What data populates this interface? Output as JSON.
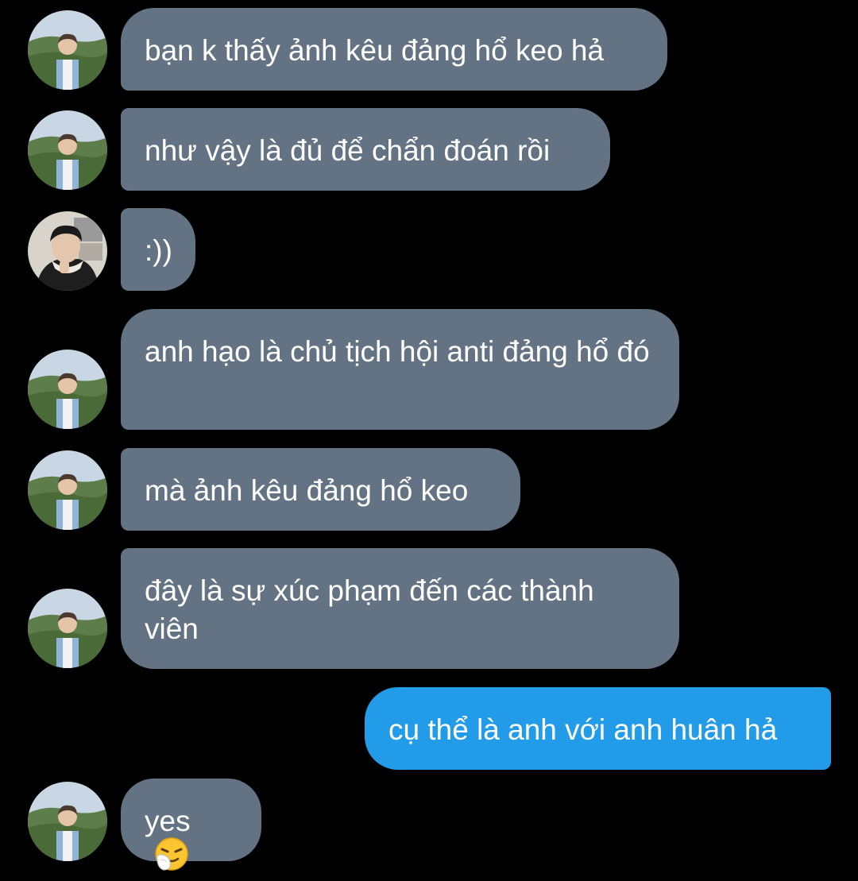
{
  "conversation": {
    "messages": [
      {
        "sender": "contact",
        "text": "bạn k thấy ảnh kêu đảng hổ keo hả",
        "avatar": "landscape-portrait-avatar"
      },
      {
        "sender": "contact",
        "text": "như vậy là đủ để chẩn đoán rồi",
        "avatar": "landscape-portrait-avatar"
      },
      {
        "sender": "contact",
        "text": ":))",
        "avatar": "indoor-portrait-avatar"
      },
      {
        "sender": "contact",
        "text": "anh hạo là chủ tịch hội anti đảng hổ đó",
        "avatar": "landscape-portrait-avatar"
      },
      {
        "sender": "contact",
        "text": "mà ảnh kêu đảng hổ keo",
        "avatar": "landscape-portrait-avatar"
      },
      {
        "sender": "contact",
        "text": "đây là sự xúc phạm đến các thành viên",
        "avatar": "landscape-portrait-avatar"
      },
      {
        "sender": "me",
        "text": "cụ thể là anh với anh huân hả"
      },
      {
        "sender": "contact",
        "text": "yes",
        "emoji": "sneezing-face-emoji",
        "avatar": "landscape-portrait-avatar"
      }
    ]
  },
  "colors": {
    "background": "#000000",
    "incoming_bubble": "#637383",
    "outgoing_bubble": "#229ce8",
    "text": "#ffffff"
  }
}
